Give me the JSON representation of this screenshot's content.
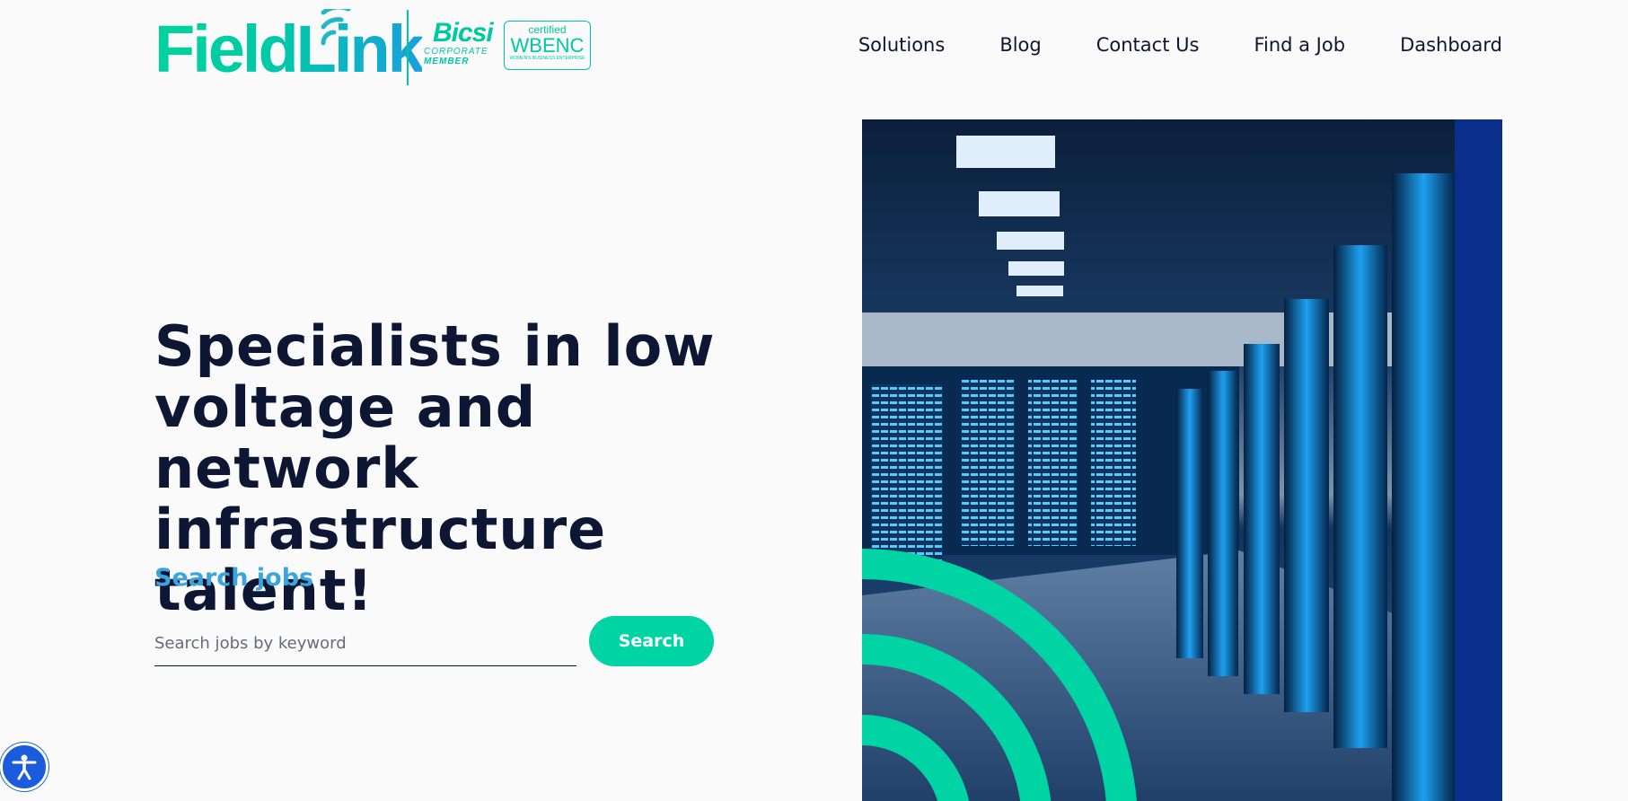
{
  "header": {
    "logo_text": "FieldLink",
    "badges": {
      "bicsi_name": "Bicsi",
      "bicsi_line1": "CORPORATE",
      "bicsi_line2": "MEMBER",
      "wbenc_certified": "certified",
      "wbenc_name": "WBENC",
      "wbenc_sub": "WOMEN'S BUSINESS ENTERPRISE"
    },
    "nav": [
      {
        "label": "Solutions"
      },
      {
        "label": "Blog"
      },
      {
        "label": "Contact Us"
      },
      {
        "label": "Find a Job"
      },
      {
        "label": "Dashboard"
      }
    ]
  },
  "hero": {
    "title": "Specialists in low voltage and network infrastructure talent!",
    "search_label": "Search jobs",
    "search_placeholder": "Search jobs by keyword",
    "search_button": "Search"
  },
  "colors": {
    "accent_green": "#00d4a4",
    "accent_blue": "#3aa5dd",
    "text_dark": "#0d1633",
    "accessibility_blue": "#1a5cdc"
  },
  "icons": {
    "accessibility": "accessibility-icon",
    "wifi": "wifi-icon"
  }
}
